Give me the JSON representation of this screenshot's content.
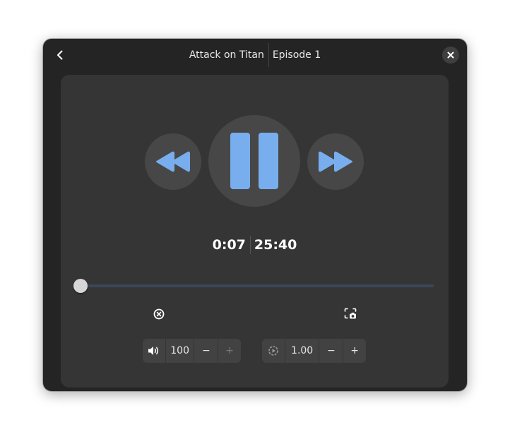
{
  "header": {
    "title": "Attack on Titan",
    "subtitle": "Episode 1",
    "back_icon": "go-previous-icon",
    "close_icon": "window-close-icon"
  },
  "controls": {
    "rewind_icon": "seek-backward-icon",
    "play_pause_icon": "pause-icon",
    "forward_icon": "seek-forward-icon",
    "accent_color": "#78aeed"
  },
  "playback": {
    "elapsed": "0:07",
    "total": "25:40",
    "progress_fraction": 0.0045
  },
  "actions": {
    "stop_icon": "stop-circle-icon",
    "screenshot_icon": "screenshot-camera-icon"
  },
  "volume": {
    "icon": "speaker-volume-icon",
    "value": "100",
    "decrease_label": "−",
    "increase_label": "+"
  },
  "speed": {
    "icon": "playback-speed-icon",
    "value": "1.00",
    "decrease_label": "−",
    "increase_label": "+"
  }
}
